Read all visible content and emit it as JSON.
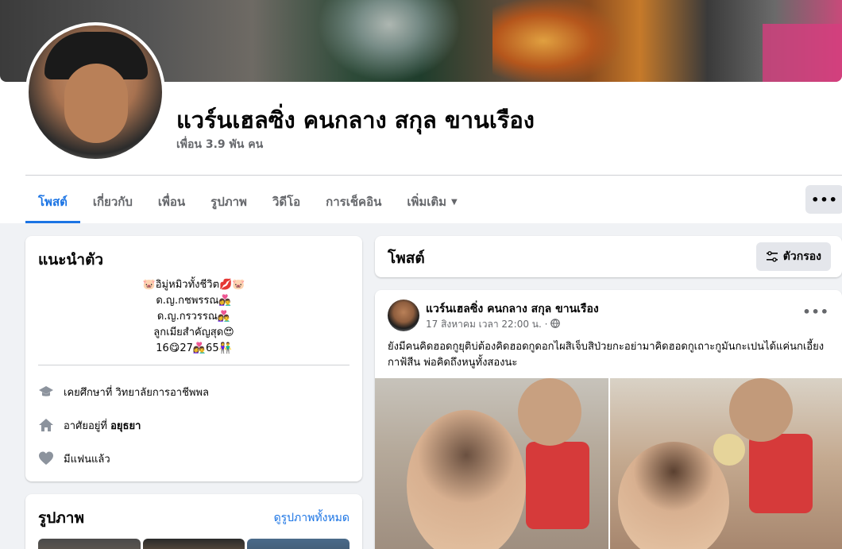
{
  "profile": {
    "name": "แวร์นเฮลซิ่ง คนกลาง สกุล ขานเรือง",
    "friends": "เพื่อน 3.9 พัน คน"
  },
  "tabs": [
    {
      "label": "โพสต์"
    },
    {
      "label": "เกี่ยวกับ"
    },
    {
      "label": "เพื่อน"
    },
    {
      "label": "รูปภาพ"
    },
    {
      "label": "วิดีโอ"
    },
    {
      "label": "การเช็คอิน"
    },
    {
      "label": "เพิ่มเติม"
    }
  ],
  "more_button": "•••",
  "intro": {
    "title": "แนะนำตัว",
    "bio_lines": [
      "🐷อิมู่หมิวทั้งชีวิต💋🐷",
      "ด.ญ.กชพรรณ👩‍❤️‍👨",
      "ด.ญ.กรวรรณ👩‍❤️‍👨",
      "ลูกเมียสำคัญสุด😍",
      "16😋27👩‍❤️‍👨65👫"
    ],
    "studied_prefix": "เคยศึกษาที่ ",
    "studied_place": "วิทยาลัยการอาชีพพล",
    "lives_prefix": "อาศัยอยู่ที่ ",
    "lives_place": "อยุธยา",
    "relationship": "มีแฟนแล้ว"
  },
  "photos": {
    "title": "รูปภาพ",
    "see_all": "ดูรูปภาพทั้งหมด"
  },
  "posts_header": {
    "title": "โพสต์",
    "filter_label": "ตัวกรอง"
  },
  "post": {
    "author": "แวร์นเฮลซิ่ง คนกลาง สกุล ขานเรือง",
    "time": "17 สิงหาคม เวลา 22:00 น. ·",
    "text": "ยังมีคนคิดฮอดกูยุติบ่ต้องคิดฮอดกูดอกไผสิเจ็บสิป่วยกะอย่ามาคิดฮอดกูเถาะกูมันกะเปนได้แค่นกเอี้ยง กาฟ้สีน  พ่อคิดถึงหนูทั้งสองนะ",
    "more": "•••"
  },
  "colors": {
    "accent": "#1b74e4",
    "muted_text": "#65676b",
    "background": "#f0f2f5"
  }
}
